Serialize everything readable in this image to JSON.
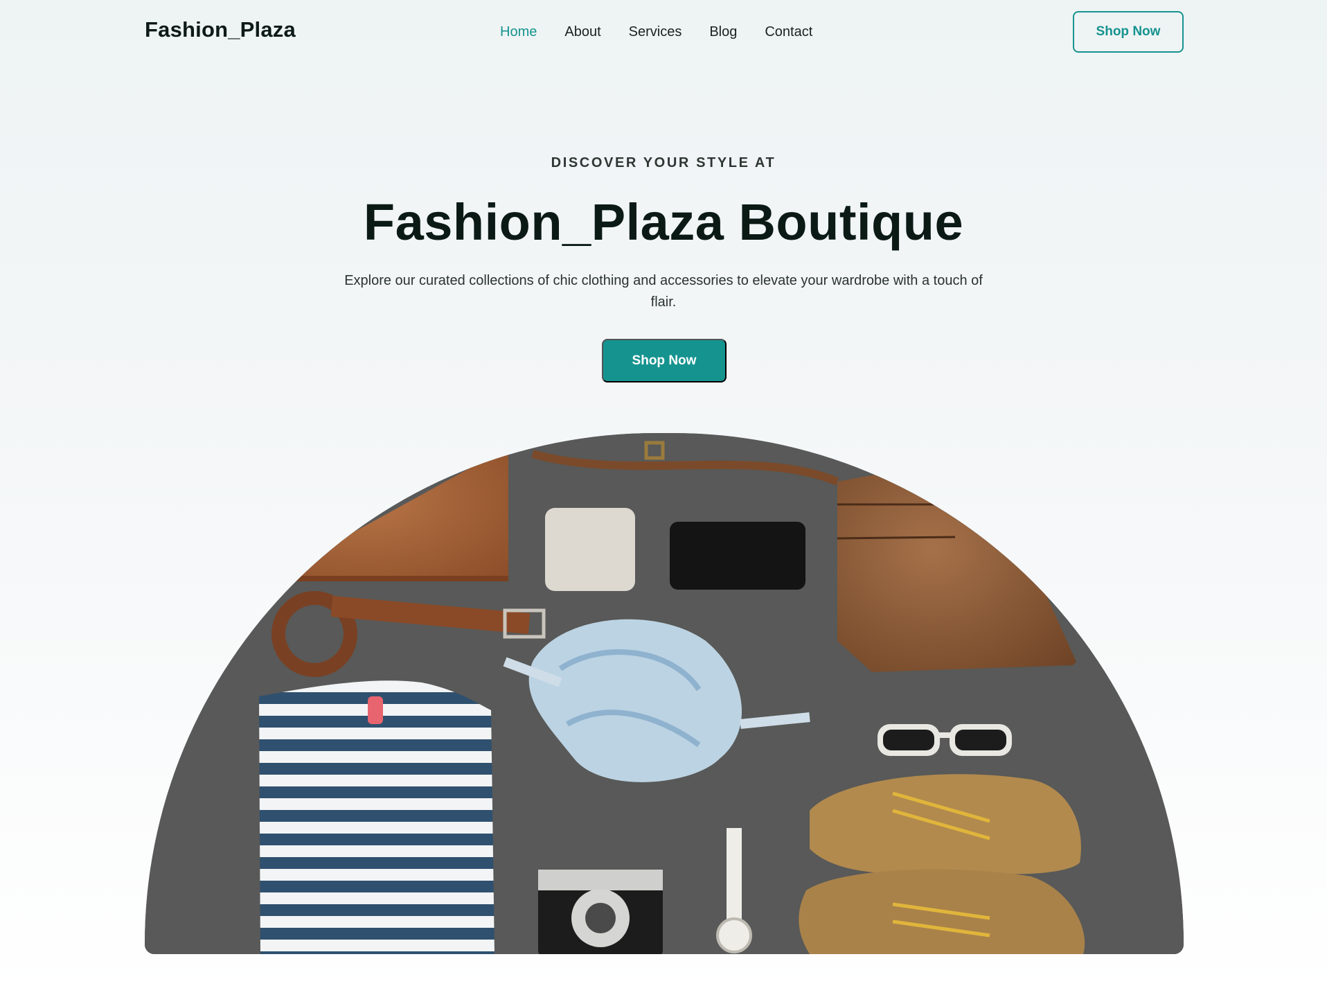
{
  "brand": "Fashion_Plaza",
  "nav": {
    "items": [
      {
        "label": "Home",
        "active": true
      },
      {
        "label": "About",
        "active": false
      },
      {
        "label": "Services",
        "active": false
      },
      {
        "label": "Blog",
        "active": false
      },
      {
        "label": "Contact",
        "active": false
      }
    ],
    "cta_label": "Shop Now"
  },
  "hero": {
    "eyebrow": "DISCOVER YOUR STYLE AT",
    "title": "Fashion_Plaza Boutique",
    "description": "Explore our curated collections of chic clothing and accessories to elevate your wardrobe with a touch of flair.",
    "cta_label": "Shop Now"
  },
  "image": {
    "icon": "flat-lay-fashion-accessories-image"
  },
  "colors": {
    "accent": "#15938f",
    "text_dark": "#0d1a17",
    "background": "#eef3f4"
  }
}
